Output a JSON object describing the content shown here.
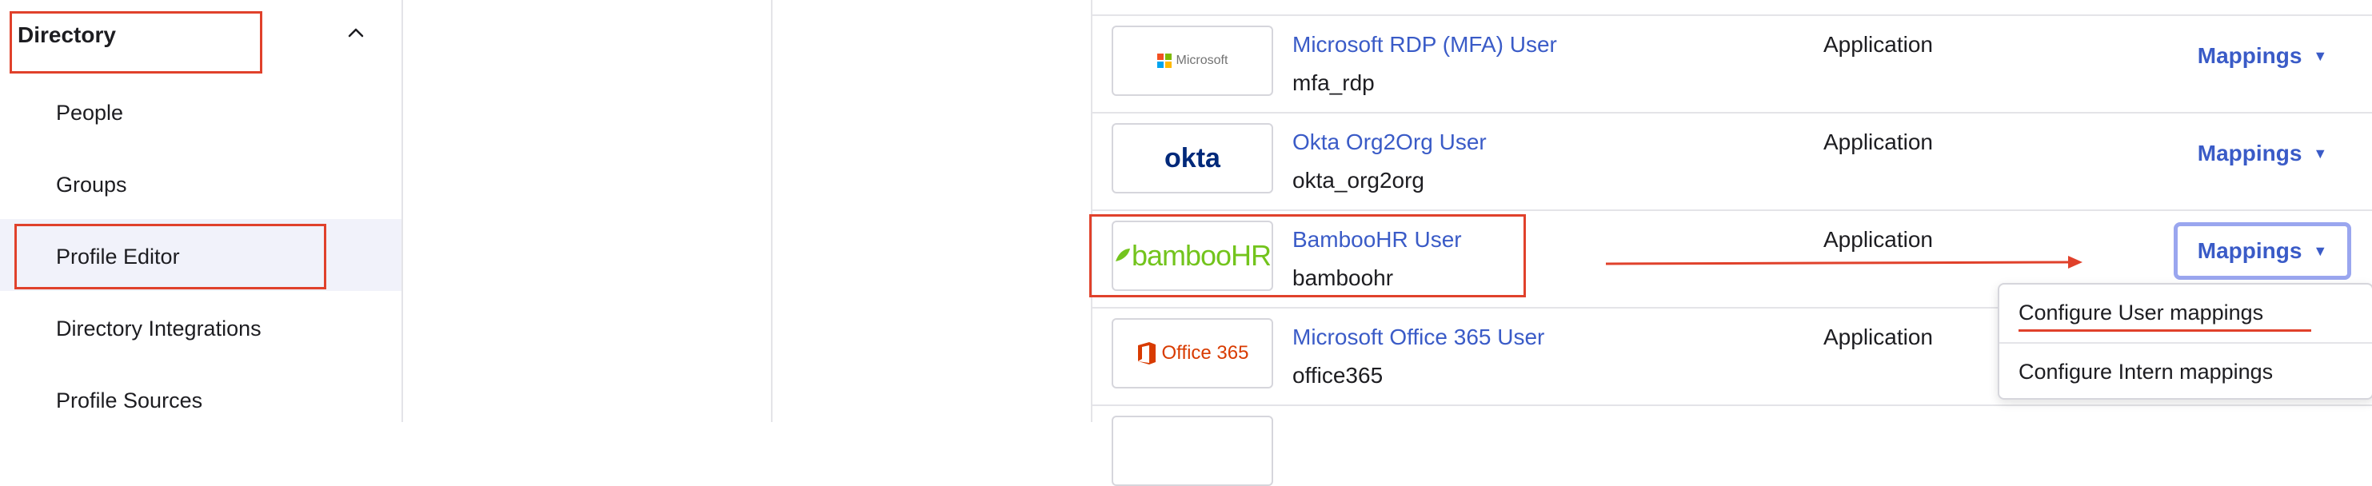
{
  "sidebar": {
    "header": "Directory",
    "items": [
      {
        "label": "People"
      },
      {
        "label": "Groups"
      },
      {
        "label": "Profile Editor",
        "active": true
      },
      {
        "label": "Directory Integrations"
      },
      {
        "label": "Profile Sources"
      }
    ]
  },
  "apps": [
    {
      "logo": "Microsoft",
      "name": "Microsoft RDP (MFA) User",
      "key": "mfa_rdp",
      "type": "Application",
      "action": "Mappings"
    },
    {
      "logo": "okta",
      "name": "Okta Org2Org User",
      "key": "okta_org2org",
      "type": "Application",
      "action": "Mappings"
    },
    {
      "logo": "bambooHR",
      "name": "BambooHR User",
      "key": "bamboohr",
      "type": "Application",
      "action": "Mappings"
    },
    {
      "logo": "Office 365",
      "name": "Microsoft Office 365 User",
      "key": "office365",
      "type": "Application",
      "action": ""
    }
  ],
  "dropdown": {
    "items": [
      "Configure User mappings",
      "Configure Intern mappings"
    ]
  },
  "colors": {
    "link": "#3a5bc7",
    "annotation": "#e0412b",
    "focus_ring": "#9aa6ef",
    "active_bg": "#f1f2fa"
  }
}
